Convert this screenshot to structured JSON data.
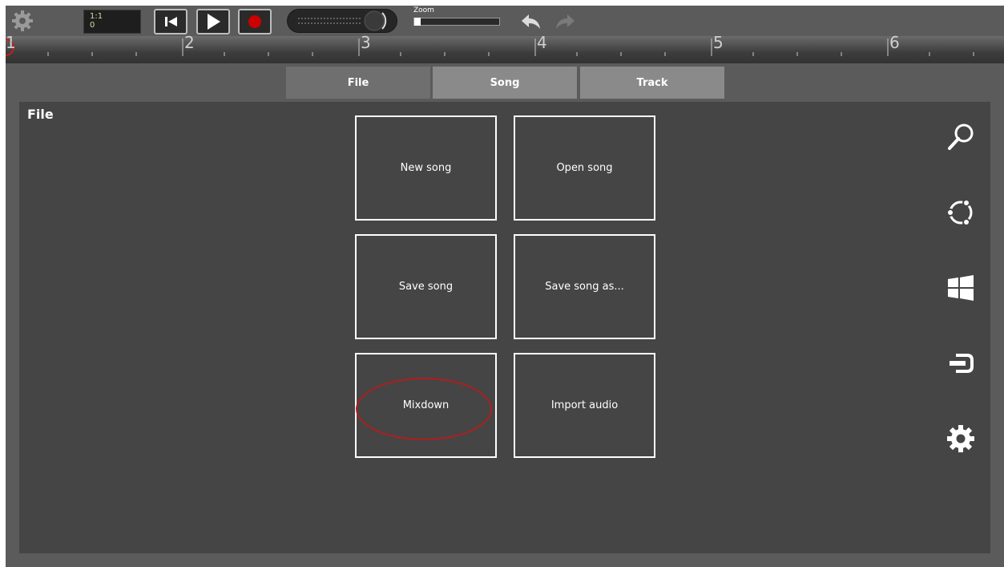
{
  "toolbar": {
    "position": {
      "bar_beat": "1:1",
      "tick": "0"
    },
    "transport": {
      "rewind_icon": "skip-to-start-icon",
      "play_icon": "play-icon",
      "record_icon": "record-icon"
    },
    "zoom": {
      "label": "Zoom",
      "level": 0.02
    },
    "undo_icon": "undo-icon",
    "redo_icon": "redo-icon"
  },
  "ruler": {
    "bars": [
      "1",
      "2",
      "3",
      "4",
      "5",
      "6"
    ]
  },
  "tabs": [
    {
      "label": "File",
      "active": true
    },
    {
      "label": "Song",
      "active": false
    },
    {
      "label": "Track",
      "active": false
    }
  ],
  "panel": {
    "title": "File",
    "tiles": [
      {
        "label": "New song"
      },
      {
        "label": "Open song"
      },
      {
        "label": "Save song"
      },
      {
        "label": "Save song as..."
      },
      {
        "label": "Mixdown",
        "highlighted": true
      },
      {
        "label": "Import audio"
      }
    ]
  },
  "sidebar_icons": [
    "search-icon",
    "share-icon",
    "windows-icon",
    "connect-icon",
    "settings-icon"
  ],
  "colors": {
    "background": "#5b5b5b",
    "panel": "#454545",
    "highlight": "#b01e1e",
    "record": "#cc0000"
  }
}
